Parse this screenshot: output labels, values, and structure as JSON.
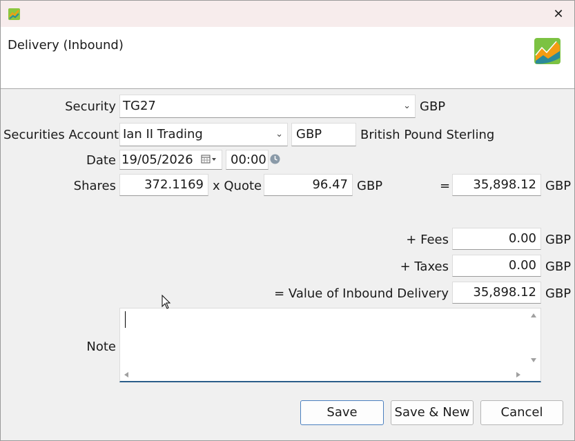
{
  "dialog": {
    "title": "Delivery (Inbound)",
    "close_glyph": "✕"
  },
  "security": {
    "label": "Security",
    "value": "TG27",
    "currency": "GBP"
  },
  "account": {
    "label": "Securities Account",
    "value": "Ian II Trading",
    "currency_code": "GBP",
    "currency_name": "British Pound Sterling"
  },
  "date": {
    "label": "Date",
    "value": "19/05/2026",
    "time": "00:00"
  },
  "shares": {
    "label": "Shares",
    "value": "372.1169",
    "quote_label": "x Quote",
    "quote_value": "96.47",
    "quote_currency": "GBP",
    "equals": "=",
    "total": "35,898.12",
    "total_currency": "GBP"
  },
  "fees": {
    "label": "+ Fees",
    "value": "0.00",
    "currency": "GBP"
  },
  "taxes": {
    "label": "+ Taxes",
    "value": "0.00",
    "currency": "GBP"
  },
  "value": {
    "label": "= Value of Inbound Delivery",
    "value": "35,898.12",
    "currency": "GBP"
  },
  "note": {
    "label": "Note",
    "value": ""
  },
  "buttons": {
    "save": "Save",
    "save_new": "Save & New",
    "cancel": "Cancel"
  },
  "colors": {
    "accent": "#2a5d8a",
    "titlebar": "#f7ecec",
    "logo_green": "#7cc242",
    "logo_orange": "#f39c12",
    "logo_teal": "#2b8a9a"
  }
}
